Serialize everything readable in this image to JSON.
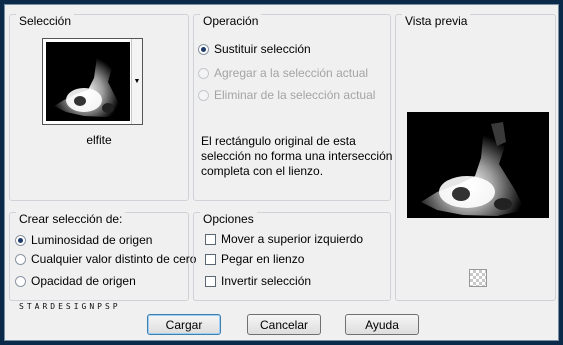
{
  "selection": {
    "title": "Selección",
    "thumbnail_name": "elfite"
  },
  "operation": {
    "title": "Operación",
    "options": [
      {
        "label": "Sustituir selección",
        "selected": true,
        "enabled": true
      },
      {
        "label": "Agregar a la selección actual",
        "selected": false,
        "enabled": false
      },
      {
        "label": "Eliminar de la selección actual",
        "selected": false,
        "enabled": false
      }
    ],
    "message_lines": [
      "El rectángulo original de esta",
      "selección no forma una intersección",
      "completa con el lienzo."
    ]
  },
  "preview": {
    "title": "Vista previa",
    "zoom_icon": "transparency-checker-icon"
  },
  "create": {
    "title": "Crear selección de:",
    "options": [
      {
        "label": "Luminosidad de origen",
        "selected": true
      },
      {
        "label": "Cualquier valor distinto de cero",
        "selected": false
      },
      {
        "label": "Opacidad de origen",
        "selected": false
      }
    ]
  },
  "options": {
    "title": "Opciones",
    "checks": [
      {
        "label": "Mover a superior izquierdo",
        "checked": false
      },
      {
        "label": "Pegar en lienzo",
        "checked": false
      },
      {
        "label": "Invertir selección",
        "checked": false
      }
    ]
  },
  "watermark": "STARDESIGNPSP",
  "buttons": {
    "load": "Cargar",
    "cancel": "Cancelar",
    "help": "Ayuda"
  },
  "colors": {
    "frame": "#0b2a4a",
    "dialog_bg": "#f0f0f0",
    "default_button_border": "#3c7fb1"
  }
}
